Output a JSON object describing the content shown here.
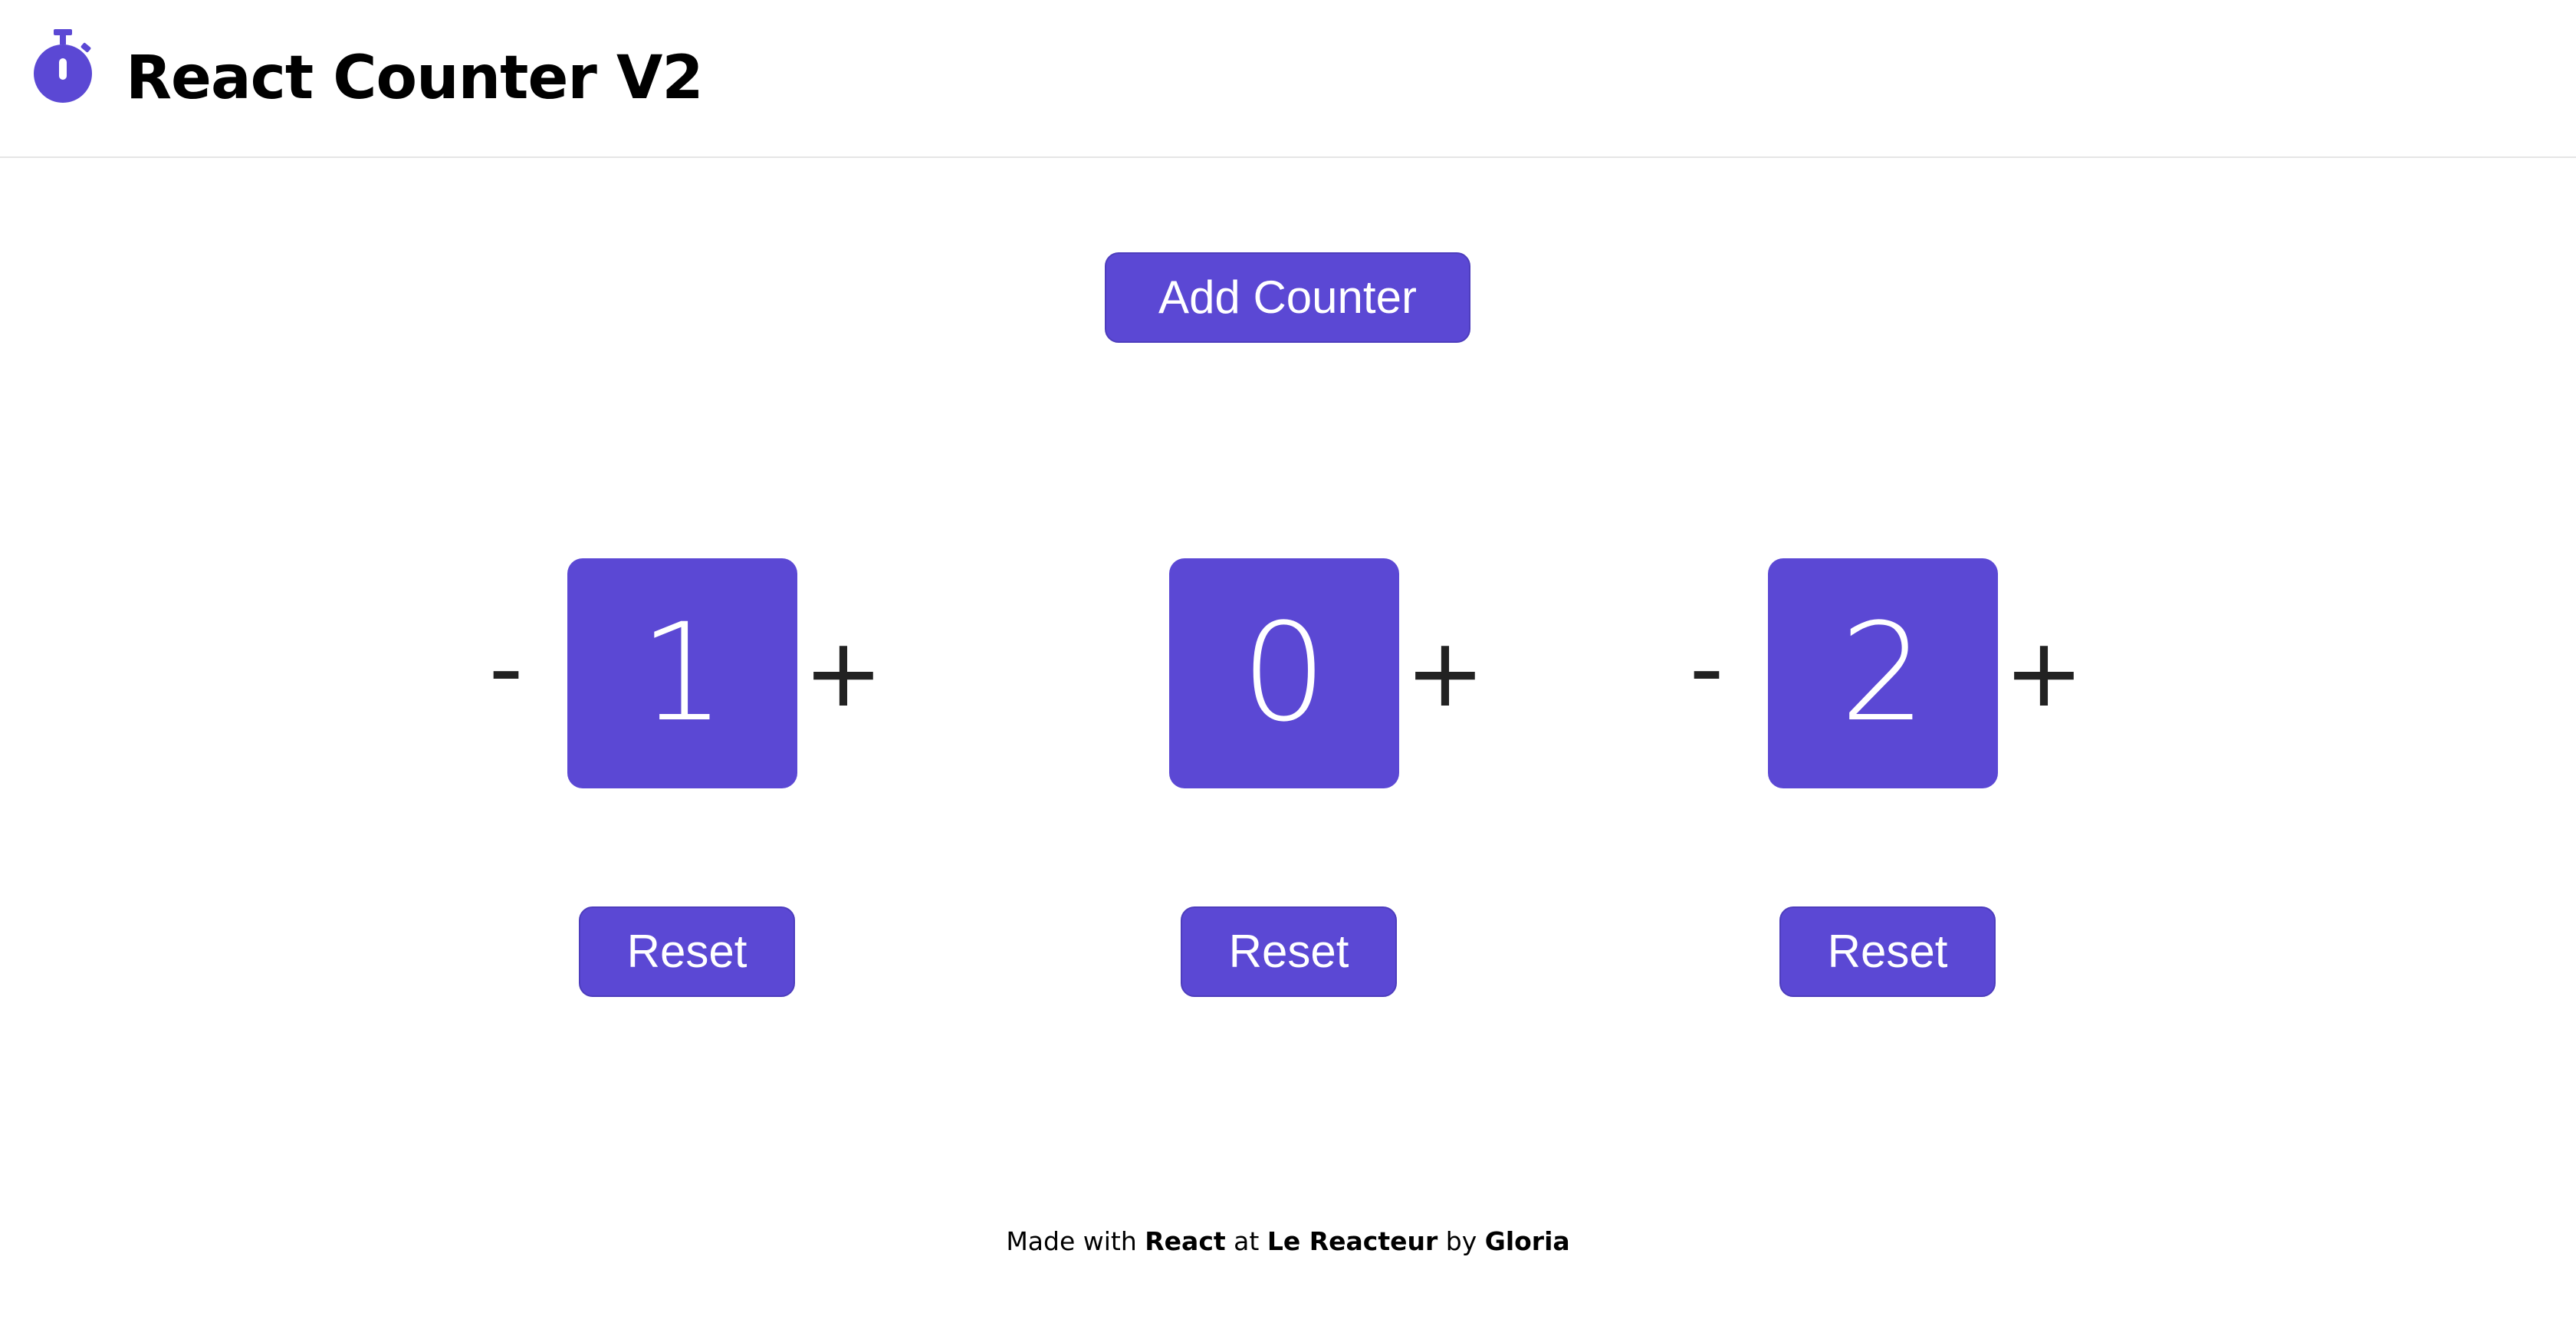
{
  "header": {
    "title": "React Counter V2",
    "logo_icon": "stopwatch-icon"
  },
  "toolbar": {
    "add_counter_label": "Add Counter"
  },
  "counters": [
    {
      "value": "1",
      "minus_label": "-",
      "plus_label": "+",
      "reset_label": "Reset",
      "show_minus": true
    },
    {
      "value": "0",
      "minus_label": "",
      "plus_label": "+",
      "reset_label": "Reset",
      "show_minus": false
    },
    {
      "value": "2",
      "minus_label": "-",
      "plus_label": "+",
      "reset_label": "Reset",
      "show_minus": true
    }
  ],
  "footer": {
    "text_1": "Made with ",
    "link_1": "React",
    "text_2": " at ",
    "link_2": "Le Reacteur",
    "text_3": " by ",
    "link_3": "Gloria"
  },
  "colors": {
    "accent": "#5b48d4",
    "operator": "#222222",
    "divider": "#e6e6e6"
  }
}
